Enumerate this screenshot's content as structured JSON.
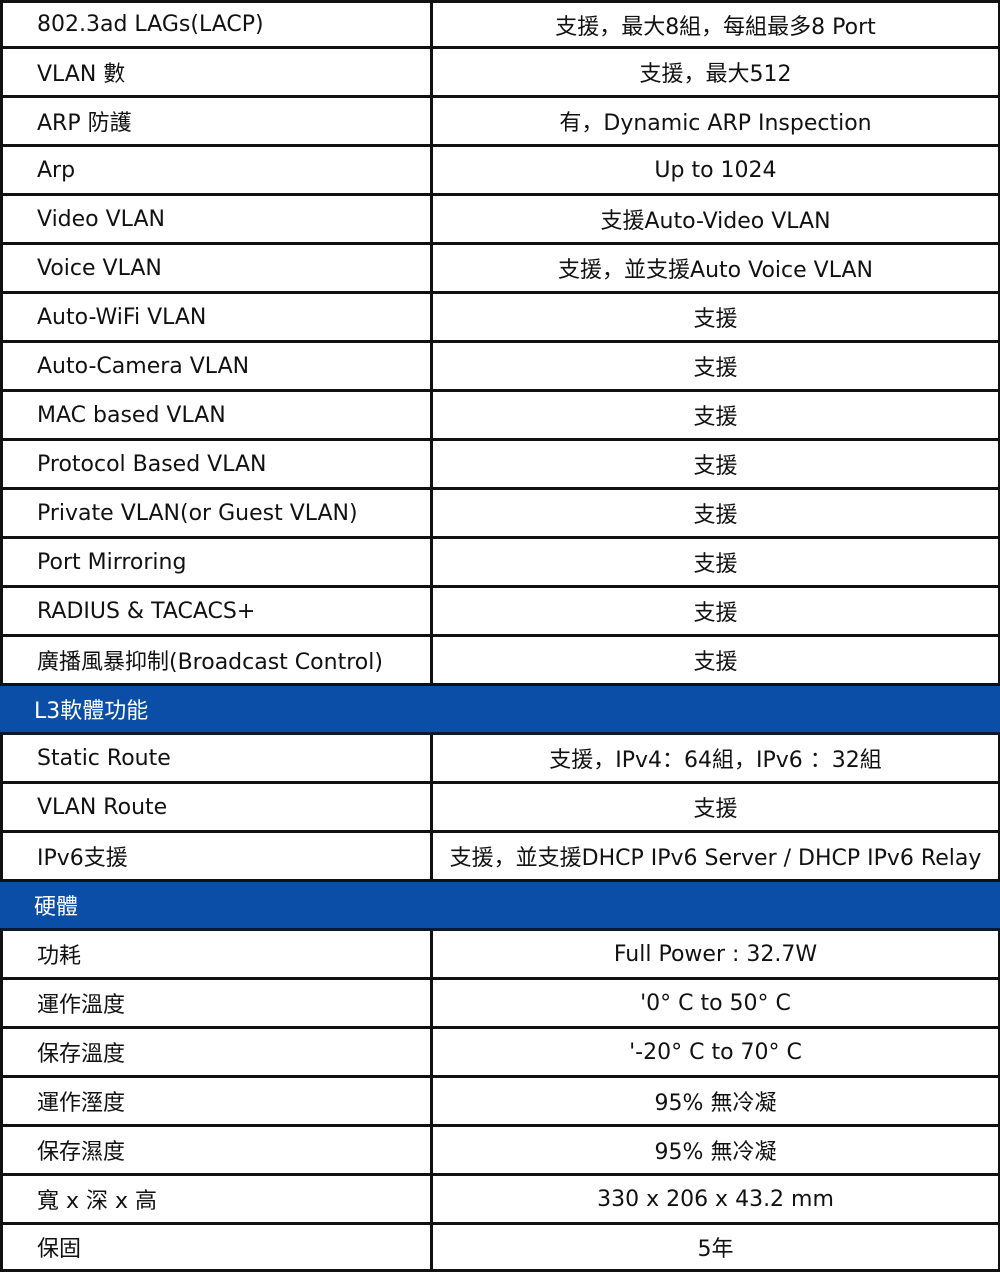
{
  "rows": [
    {
      "type": "item",
      "label": "802.3ad LAGs(LACP)",
      "value": "支援，最大8組，每組最多8 Port"
    },
    {
      "type": "item",
      "label": "VLAN 數",
      "value": "支援，最大512"
    },
    {
      "type": "item",
      "label": "ARP 防護",
      "value": "有，Dynamic ARP Inspection"
    },
    {
      "type": "item",
      "label": "Arp",
      "value": "Up to 1024"
    },
    {
      "type": "item",
      "label": "Video VLAN",
      "value": "支援Auto-Video VLAN"
    },
    {
      "type": "item",
      "label": "Voice VLAN",
      "value": "支援，並支援Auto Voice VLAN"
    },
    {
      "type": "item",
      "label": "Auto-WiFi VLAN",
      "value": "支援"
    },
    {
      "type": "item",
      "label": "Auto-Camera VLAN",
      "value": "支援"
    },
    {
      "type": "item",
      "label": "MAC based VLAN",
      "value": "支援"
    },
    {
      "type": "item",
      "label": "Protocol Based VLAN",
      "value": "支援"
    },
    {
      "type": "item",
      "label": "Private VLAN(or Guest VLAN)",
      "value": "支援"
    },
    {
      "type": "item",
      "label": "Port Mirroring",
      "value": "支援"
    },
    {
      "type": "item",
      "label": "RADIUS & TACACS+",
      "value": "支援"
    },
    {
      "type": "item",
      "label": "廣播風暴抑制(Broadcast Control)",
      "value": "支援"
    },
    {
      "type": "section",
      "label": "L3軟體功能"
    },
    {
      "type": "item",
      "label": "Static Route",
      "value": "支援，IPv4：64組，IPv6 ：32組"
    },
    {
      "type": "item",
      "label": "VLAN Route",
      "value": "支援"
    },
    {
      "type": "item",
      "label": "IPv6支援",
      "value": "支援，並支援DHCP IPv6 Server / DHCP IPv6 Relay"
    },
    {
      "type": "section",
      "label": "硬體"
    },
    {
      "type": "item",
      "label": "功耗",
      "value": "Full Power : 32.7W"
    },
    {
      "type": "item",
      "label": "運作溫度",
      "value": "'0° C to 50° C"
    },
    {
      "type": "item",
      "label": "保存溫度",
      "value": "'-20° C to 70° C"
    },
    {
      "type": "item",
      "label": "運作溼度",
      "value": "95% 無冷凝"
    },
    {
      "type": "item",
      "label": "保存濕度",
      "value": "95% 無冷凝"
    },
    {
      "type": "item",
      "label": "寬 x 深 x 高",
      "value": "330 x 206 x 43.2 mm"
    },
    {
      "type": "item",
      "label": "保固",
      "value": "5年"
    }
  ],
  "colors": {
    "section_bg": "#0b4ea8",
    "section_text": "#ffffff",
    "border": "#111111"
  }
}
